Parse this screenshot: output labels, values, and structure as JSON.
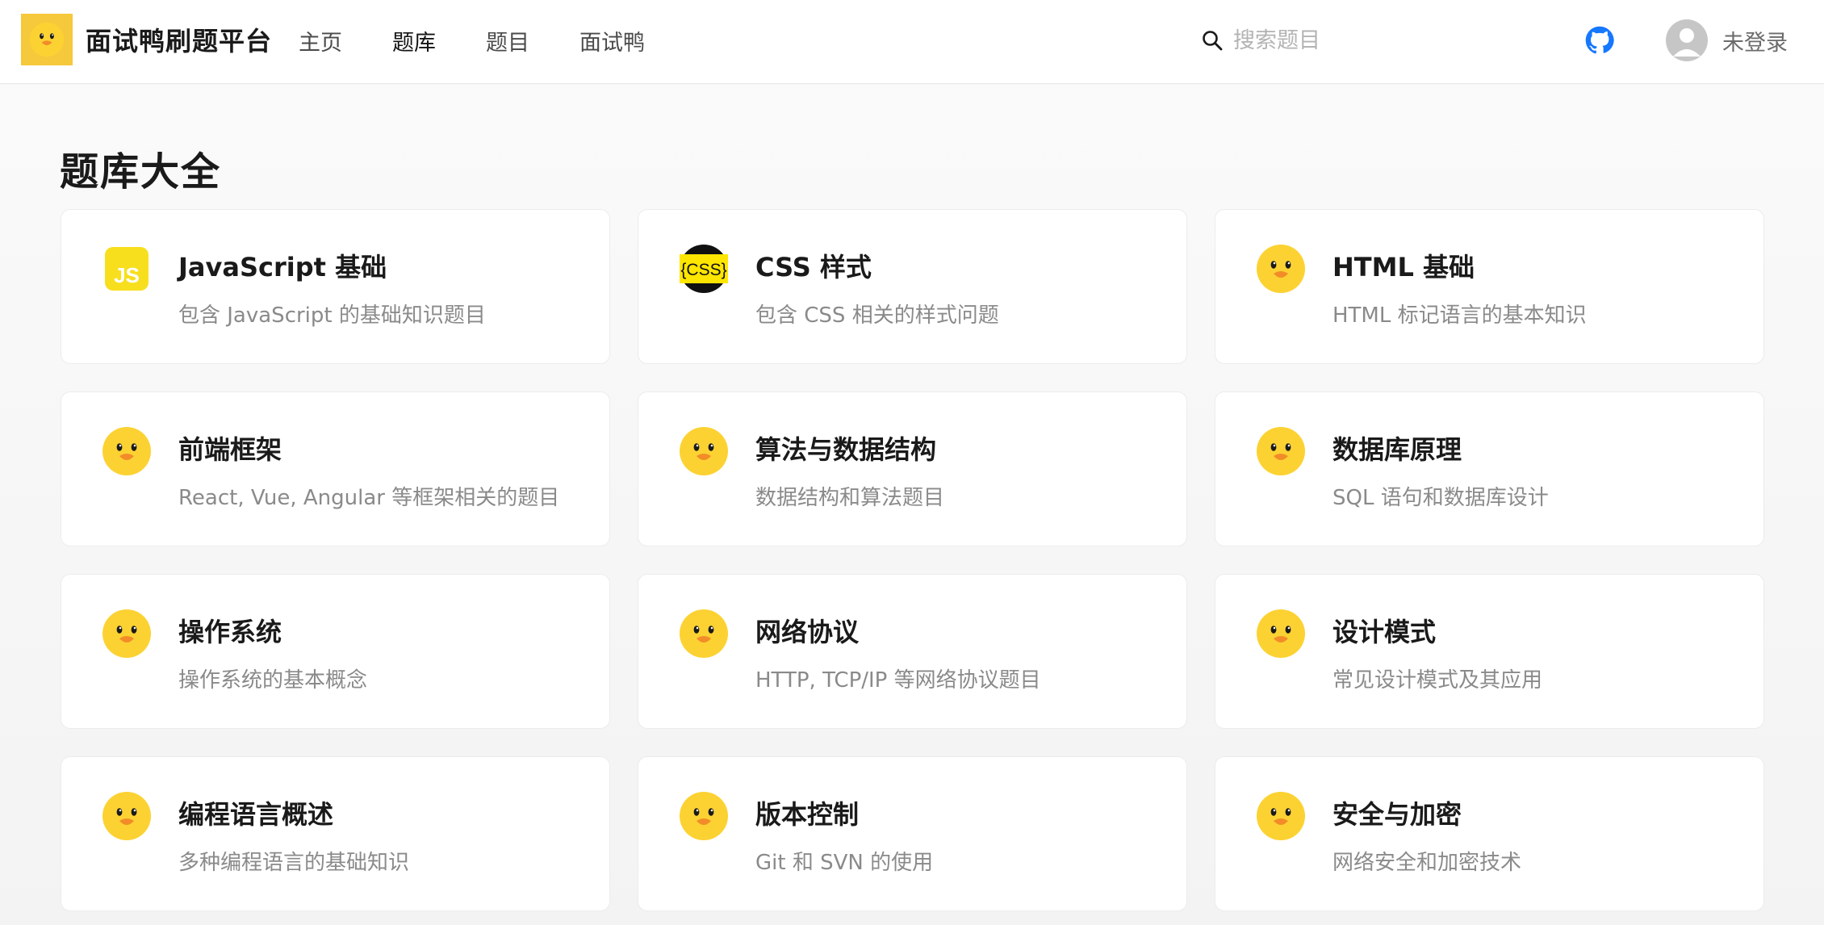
{
  "brand": {
    "title": "面试鸭刷题平台",
    "logo_icon": "duck-icon"
  },
  "nav": {
    "items": [
      {
        "label": "主页",
        "active": false
      },
      {
        "label": "题库",
        "active": true
      },
      {
        "label": "题目",
        "active": false
      },
      {
        "label": "面试鸭",
        "active": false
      }
    ]
  },
  "search": {
    "placeholder": "搜索题目",
    "value": "",
    "icon": "search-icon"
  },
  "header": {
    "github_icon": "github-icon"
  },
  "user": {
    "name": "未登录",
    "avatar_icon": "avatar-icon"
  },
  "main": {
    "title": "题库大全",
    "cards": [
      {
        "title": "JavaScript 基础",
        "desc": "包含 JavaScript 的基础知识题目",
        "icon": "js-icon"
      },
      {
        "title": "CSS 样式",
        "desc": "包含 CSS 相关的样式问题",
        "icon": "css-icon",
        "icon_text": "{CSS}"
      },
      {
        "title": "HTML 基础",
        "desc": "HTML 标记语言的基本知识",
        "icon": "duck-icon"
      },
      {
        "title": "前端框架",
        "desc": "React, Vue, Angular 等框架相关的题目",
        "icon": "duck-icon"
      },
      {
        "title": "算法与数据结构",
        "desc": "数据结构和算法题目",
        "icon": "duck-icon"
      },
      {
        "title": "数据库原理",
        "desc": "SQL 语句和数据库设计",
        "icon": "duck-icon"
      },
      {
        "title": "操作系统",
        "desc": "操作系统的基本概念",
        "icon": "duck-icon"
      },
      {
        "title": "网络协议",
        "desc": "HTTP, TCP/IP 等网络协议题目",
        "icon": "duck-icon"
      },
      {
        "title": "设计模式",
        "desc": "常见设计模式及其应用",
        "icon": "duck-icon"
      },
      {
        "title": "编程语言概述",
        "desc": "多种编程语言的基础知识",
        "icon": "duck-icon"
      },
      {
        "title": "版本控制",
        "desc": "Git 和 SVN 的使用",
        "icon": "duck-icon"
      },
      {
        "title": "安全与加密",
        "desc": "网络安全和加密技术",
        "icon": "duck-icon"
      }
    ]
  },
  "colors": {
    "brand_yellow": "#f6c83b",
    "duck_yellow": "#fcd233",
    "beak_orange": "#f28c28",
    "github_blue": "#1677ff",
    "js_yellow": "#f7df1e"
  }
}
